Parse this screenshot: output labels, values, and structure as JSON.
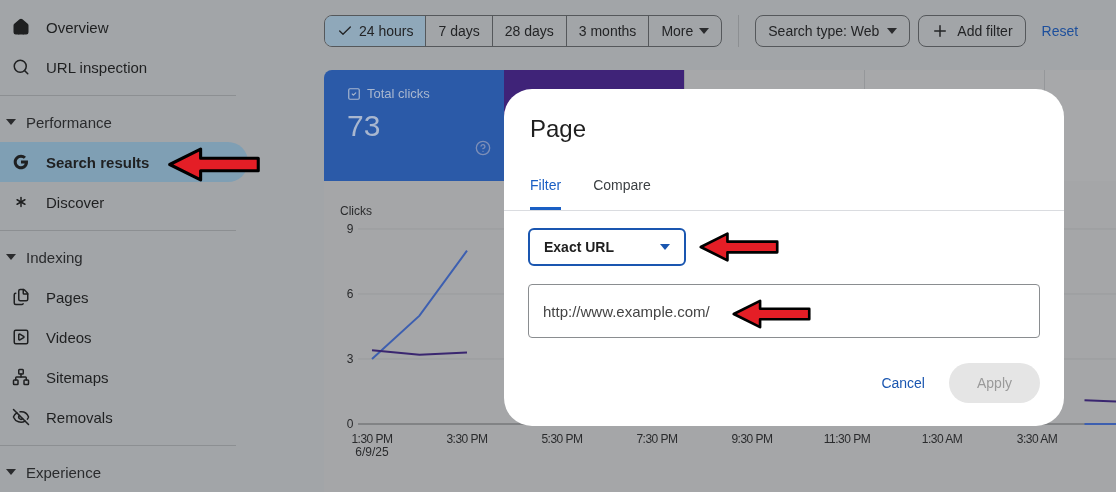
{
  "sidebar": [
    {
      "items": [
        {
          "label": "Overview",
          "selected": false
        },
        {
          "label": "URL inspection",
          "selected": false
        }
      ]
    },
    {
      "title": "Performance",
      "expanded": true,
      "items": [
        {
          "label": "Search results",
          "selected": true
        },
        {
          "label": "Discover",
          "selected": false
        }
      ]
    },
    {
      "title": "Indexing",
      "expanded": true,
      "items": [
        {
          "label": "Pages",
          "selected": false
        },
        {
          "label": "Videos",
          "selected": false
        },
        {
          "label": "Sitemaps",
          "selected": false
        },
        {
          "label": "Removals",
          "selected": false
        }
      ]
    },
    {
      "title": "Experience",
      "expanded": true
    }
  ],
  "toolbar": {
    "ranges": [
      {
        "label": "24 hours",
        "selected": true
      },
      {
        "label": "7 days",
        "selected": false
      },
      {
        "label": "28 days",
        "selected": false
      },
      {
        "label": "3 months",
        "selected": false
      }
    ],
    "more": "More",
    "search_type": "Search type: Web",
    "add_filter": "Add filter",
    "reset": "Reset"
  },
  "metrics": [
    {
      "label": "Total clicks",
      "value": "73",
      "checked": true,
      "color": "#2b5aa8"
    },
    {
      "color": "#3f2378"
    },
    {
      "color": "#a7a8aa"
    },
    {
      "color": "#a7a8aa"
    },
    {
      "color": "#a7a8aa"
    }
  ],
  "chart": {
    "date": "6/9/25",
    "chart_data": {
      "type": "line",
      "ylabel": "Clicks",
      "categories": [
        "1:30 PM",
        null,
        "3:30 PM",
        null,
        "5:30 PM",
        null,
        "7:30 PM",
        null,
        "9:30 PM",
        null,
        "11:30 PM",
        null,
        "1:30 AM",
        null,
        "3:30 AM",
        null,
        null
      ],
      "yticks": [
        0,
        3,
        6,
        9
      ],
      "ylim": [
        0,
        9
      ],
      "series": [
        {
          "color": "#3d5fb0",
          "values": [
            3,
            5,
            8,
            null,
            null,
            null,
            null,
            null,
            null,
            null,
            null,
            null,
            null,
            null,
            null,
            0,
            0
          ]
        },
        {
          "color": "#3a2670",
          "values": [
            3.4,
            3.2,
            3.3,
            null,
            null,
            null,
            null,
            null,
            null,
            null,
            null,
            null,
            null,
            null,
            null,
            1.1,
            1
          ]
        }
      ]
    }
  },
  "dialog": {
    "title": "Page",
    "tabs": [
      {
        "label": "Filter",
        "selected": true
      },
      {
        "label": "Compare",
        "selected": false
      }
    ],
    "match_type": "Exact URL",
    "url_value": "http://www.example.com/",
    "buttons": [
      {
        "label": "Cancel",
        "kind": "text",
        "disabled": false
      },
      {
        "label": "Apply",
        "kind": "filled",
        "disabled": true
      }
    ]
  }
}
